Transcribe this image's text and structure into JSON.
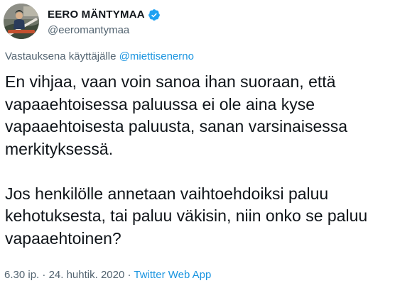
{
  "author": {
    "display_name": "EERO MÄNTYMAA",
    "handle": "@eeromantymaa",
    "verified_icon": "verified-badge-icon",
    "avatar": "profile-photo"
  },
  "reply": {
    "prefix": "Vastauksena käyttäjälle",
    "mention": "@miettisenerno"
  },
  "body": {
    "paragraph1": [
      "En vihjaa, vaan voin sanoa ihan suoraan, että",
      "vapaaehtoisessa paluussa ei ole aina kyse",
      "vapaaehtoisesta paluusta, sanan varsinaisessa",
      "merkityksessä."
    ],
    "paragraph2": [
      "Jos henkilölle annetaan vaihtoehdoiksi paluu",
      "kehotuksesta, tai paluu väkisin, niin onko se paluu",
      "vapaaehtoinen?"
    ]
  },
  "meta": {
    "time": "6.30 ip.",
    "separator1": " · ",
    "date": "24. huhtik. 2020",
    "separator2": " · ",
    "source": "Twitter Web App"
  },
  "colors": {
    "text": "#0f1419",
    "secondary": "#536471",
    "link": "#1b95e0",
    "verified": "#1da1f2"
  }
}
